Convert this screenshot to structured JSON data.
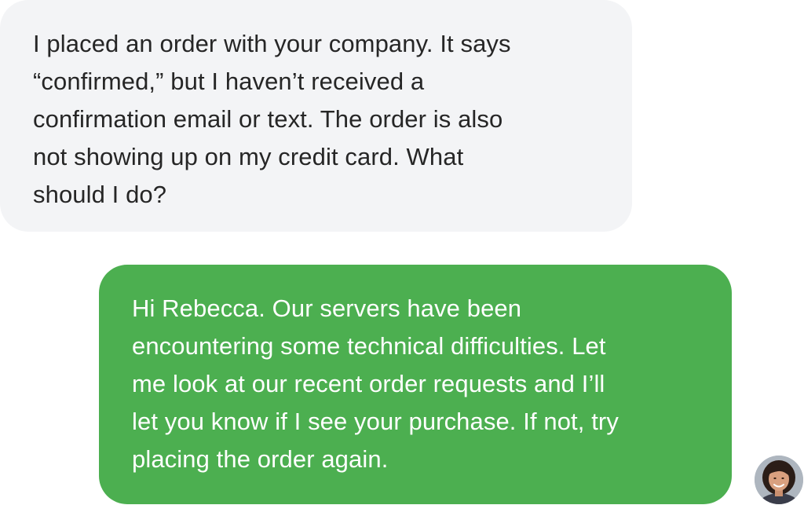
{
  "conversation": {
    "messages": [
      {
        "sender": "customer",
        "lines": [
          "I placed an order with your company. It says",
          "“confirmed,” but I haven’t received a",
          "confirmation email or text. The order is also",
          "not showing up on my credit card. What",
          "should I do?"
        ]
      },
      {
        "sender": "agent",
        "lines": [
          "Hi Rebecca. Our servers have been",
          "encountering some technical difficulties. Let",
          "me look at our recent order requests and I’ll",
          "let you know if I see your purchase. If not, try",
          "placing the order again."
        ]
      }
    ]
  },
  "colors": {
    "incoming_bubble": "#f3f4f6",
    "incoming_text": "#262626",
    "outgoing_bubble": "#4caf50",
    "outgoing_text": "#ffffff"
  },
  "avatar": {
    "icon": "user-avatar-photo"
  }
}
